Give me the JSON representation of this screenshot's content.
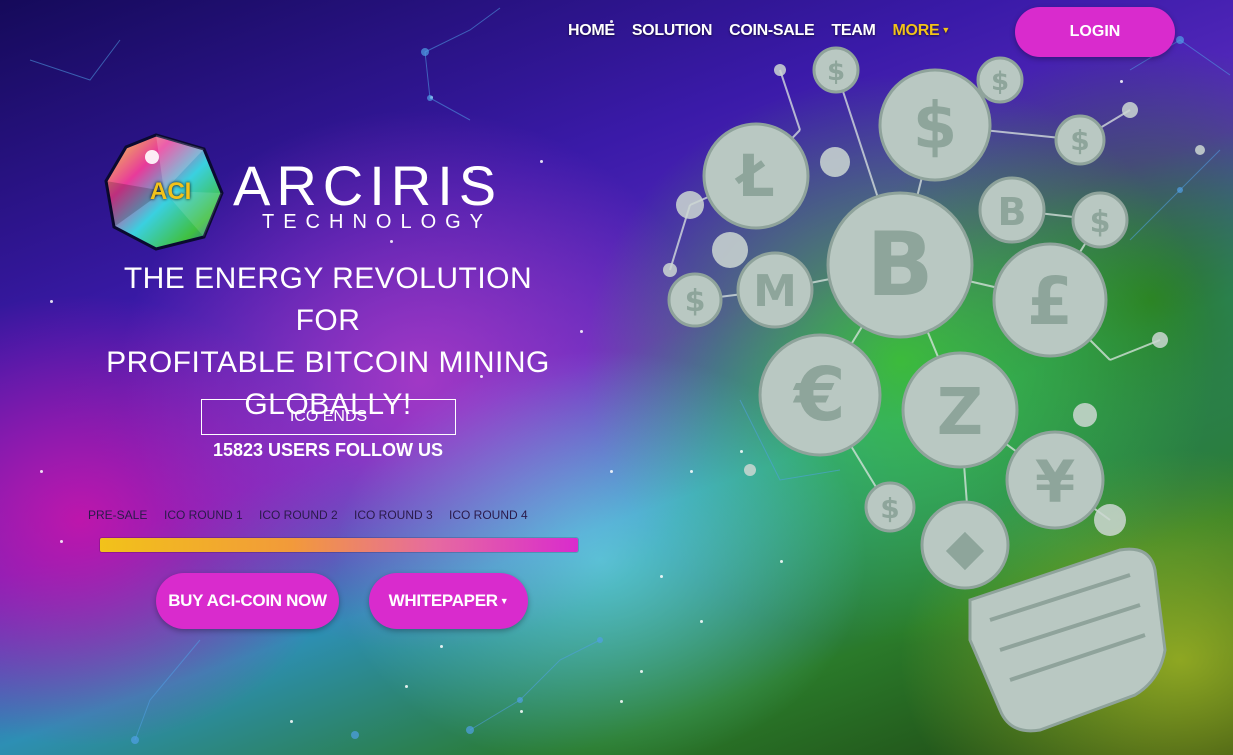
{
  "nav": {
    "items": [
      {
        "label": "HOME"
      },
      {
        "label": "SOLUTION"
      },
      {
        "label": "COIN-SALE"
      },
      {
        "label": "TEAM"
      }
    ],
    "more_label": "MORE",
    "login_label": "LOGIN"
  },
  "brand": {
    "badge": "ACI",
    "name": "ARCIRIS",
    "sub": "TECHNOLOGY"
  },
  "hero": {
    "headline_1": "THE ENERGY REVOLUTION FOR",
    "headline_2": "PROFITABLE BITCOIN MINING",
    "headline_3": "GLOBALLY!",
    "ico_ends": "ICO ENDS",
    "followers": "15823 USERS FOLLOW US"
  },
  "sale_rounds": {
    "labels": [
      "PRE-SALE",
      "ICO ROUND 1",
      "ICO ROUND 2",
      "ICO ROUND 3",
      "ICO ROUND 4"
    ],
    "progress_percent": 100
  },
  "buttons": {
    "buy": "BUY ACI-COIN NOW",
    "whitepaper": "WHITEPAPER"
  },
  "icons": {
    "bulb": "coin-lightbulb-illustration",
    "symbols": [
      "dollar",
      "litecoin",
      "bitcoin",
      "monero",
      "pound",
      "euro",
      "zcash",
      "yen",
      "ethereum"
    ]
  },
  "colors": {
    "accent": "#d92bcd",
    "more": "#f2c21a"
  }
}
